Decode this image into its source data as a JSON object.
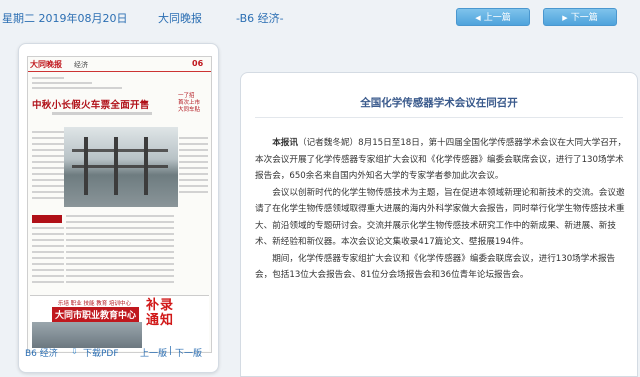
{
  "header": {
    "date": "星期二 2019年08月20日",
    "paper_name": "大同晚报",
    "page": "-B6 经济-",
    "prev_label": "上一篇",
    "next_label": "下一篇"
  },
  "thumbnail": {
    "logo": "大同晚报",
    "section": "经济",
    "page_no": "06",
    "headline": "中秋小长假火车票全面开售",
    "side_text": "一了招\n首次上市\n大同车贴",
    "ad_title_small": "乐培 职业 技能 教育 培训中心",
    "ad_title": "大同市职业教育中心",
    "ad_big": "补录\n通知"
  },
  "left_footer": {
    "page_label": "B6 经济",
    "pdf_label": "下载PDF",
    "prev_label": "上一版",
    "separator": "|",
    "next_label": "下一版"
  },
  "article": {
    "title": "全国化学传感器学术会议在同召开",
    "lead": "本报讯",
    "p1_rest": "（记者魏冬妮）8月15日至18日，第十四届全国化学传感器学术会议在大同大学召开，本次会议开展了化学传感器专家组扩大会议和《化学传感器》编委会联席会议，进行了130场学术报告会，650余名来自国内外知名大学的专家学者参加此次会议。",
    "p2": "会议以创新时代的化学生物传感技术为主题，旨在促进本领域新理论和新技术的交流。会议邀请了在化学生物传感领域取得重大进展的海内外科学家做大会报告，同时举行化学生物传感技术重大、前沿领域的专题研讨会。交流并展示化学生物传感技术研究工作中的新成果、新进展、新技术、新经验和新仪器。本次会议论文集收录417篇论文、壁报展194件。",
    "p3": "期间，化学传感器专家组扩大会议和《化学传感器》编委会联席会议，进行130场学术报告会，包括13位大会报告会、81位分会场报告会和36位青年论坛报告会。"
  }
}
